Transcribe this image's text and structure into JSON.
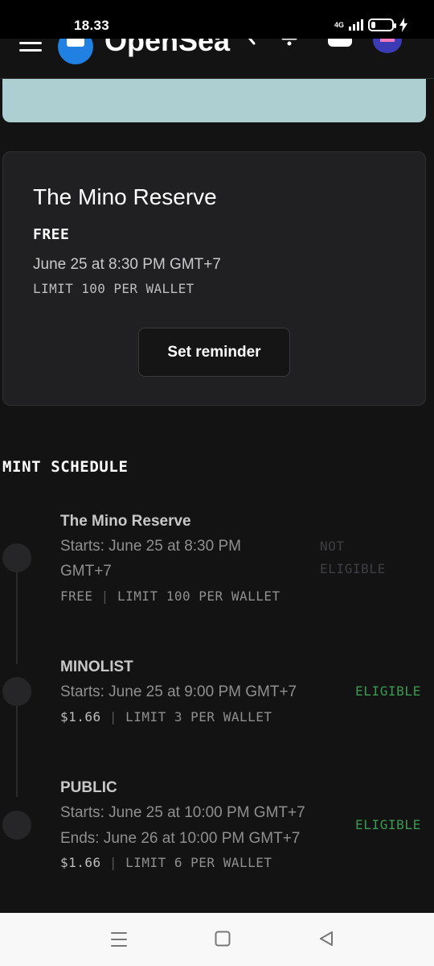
{
  "status_bar": {
    "time": "18.33",
    "network": "4G",
    "battery_level": 0.2
  },
  "nav": {
    "brand": "OpenSea",
    "icons": [
      "menu-icon",
      "opensea-logo-icon",
      "search-icon",
      "bell-icon",
      "cart-icon",
      "avatar-icon"
    ]
  },
  "drop": {
    "title": "The Mino Reserve",
    "price": "FREE",
    "date": "June 25 at 8:30 PM GMT+7",
    "limit": "LIMIT 100 PER WALLET",
    "reminder_label": "Set reminder"
  },
  "schedule": {
    "heading": "MINT SCHEDULE",
    "phases": [
      {
        "name": "The Mino Reserve",
        "starts_line1": "Starts: June 25 at 8:30 PM",
        "starts_line2": "GMT+7",
        "price": "FREE",
        "separator": "|",
        "limit": "LIMIT 100 PER WALLET",
        "status_line1": "NOT",
        "status_line2": "ELIGIBLE"
      },
      {
        "name": "MINOLIST",
        "starts": "Starts: June 25 at 9:00 PM GMT+7",
        "price": "$1.66",
        "separator": "|",
        "limit": "LIMIT 3 PER WALLET",
        "status": "ELIGIBLE"
      },
      {
        "name": "PUBLIC",
        "starts": "Starts: June 25 at 10:00 PM GMT+7",
        "ends": "Ends: June 26 at 10:00 PM GMT+7",
        "price": "$1.66",
        "separator": "|",
        "limit": "LIMIT 6 PER WALLET",
        "status": "ELIGIBLE"
      }
    ]
  },
  "android_nav": {
    "buttons": [
      "recents-icon",
      "home-icon",
      "back-icon"
    ]
  },
  "colors": {
    "background": "#131313",
    "card": "#202023",
    "banner": "#aecfd2",
    "eligible": "#3a9a52",
    "not_eligible": "#3f3f44"
  }
}
